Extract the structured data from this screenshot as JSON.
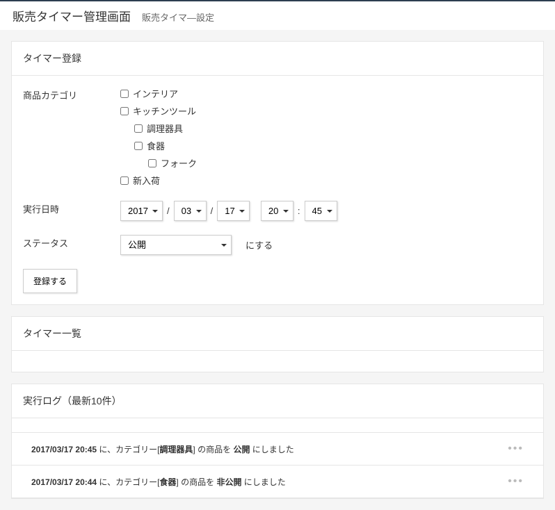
{
  "header": {
    "title": "販売タイマー管理画面",
    "subtitle": "販売タイマ―設定"
  },
  "register": {
    "panel_title": "タイマー登録",
    "category_label": "商品カテゴリ",
    "categories": [
      {
        "label": "インテリア",
        "indent": 0
      },
      {
        "label": "キッチンツール",
        "indent": 0
      },
      {
        "label": "調理器具",
        "indent": 1
      },
      {
        "label": "食器",
        "indent": 1
      },
      {
        "label": "フォーク",
        "indent": 2
      },
      {
        "label": "新入荷",
        "indent": 0
      }
    ],
    "datetime_label": "実行日時",
    "year": "2017",
    "month": "03",
    "day": "17",
    "hour": "20",
    "minute": "45",
    "status_label": "ステータス",
    "status_value": "公開",
    "status_suffix": "にする",
    "submit_label": "登録する"
  },
  "list": {
    "panel_title": "タイマー一覧"
  },
  "log": {
    "panel_title": "実行ログ（最新10件）",
    "items": [
      {
        "timestamp": "2017/03/17 20:45",
        "mid": " に、カテゴリー[",
        "category": "調理器具",
        "mid2": "] の商品を ",
        "status": "公開",
        "tail": " にしました"
      },
      {
        "timestamp": "2017/03/17 20:44",
        "mid": " に、カテゴリー[",
        "category": "食器",
        "mid2": "] の商品を ",
        "status": "非公開",
        "tail": " にしました"
      }
    ]
  }
}
